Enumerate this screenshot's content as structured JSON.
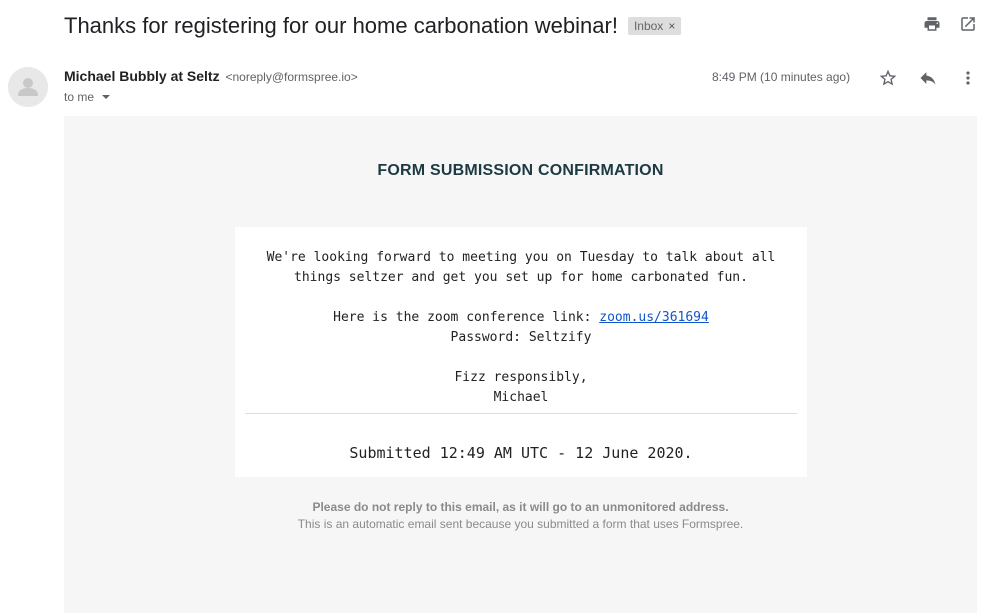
{
  "email": {
    "subject": "Thanks for registering for our home carbonation webinar!",
    "label": "Inbox",
    "label_remove": "×",
    "sender_name": "Michael Bubbly at Seltz",
    "sender_email": "<noreply@formspree.io>",
    "recipient": "to me",
    "time": "8:49 PM (10 minutes ago)"
  },
  "icons": {
    "print": "print-icon",
    "open_new_window": "open-in-new-window-icon",
    "star": "star-icon",
    "reply": "reply-icon",
    "more": "more-vert-icon",
    "avatar": "avatar-icon",
    "recipient_dropdown": "chevron-down-icon"
  },
  "body": {
    "title": "FORM SUBMISSION CONFIRMATION",
    "para1_line1": "We're looking forward to meeting you on Tuesday to talk about all",
    "para1_line2": "things seltzer and get you set up for home carbonated fun.",
    "zoom_prefix": "Here is the zoom conference link: ",
    "zoom_link": "zoom.us/361694",
    "password": "Password: Seltzify",
    "closing": "Fizz responsibly,",
    "signature": "Michael",
    "submitted": "Submitted 12:49 AM UTC - 12 June 2020.",
    "footer_bold": "Please do not reply to this email, as it will go to an unmonitored address.",
    "footer_note": "This is an automatic email sent because you submitted a form that uses Formspree."
  },
  "colors": {
    "body_background": "#f6f6f6",
    "title_color": "#1d3a43",
    "link_color": "#1155cc",
    "chip_background": "#dddddd"
  }
}
